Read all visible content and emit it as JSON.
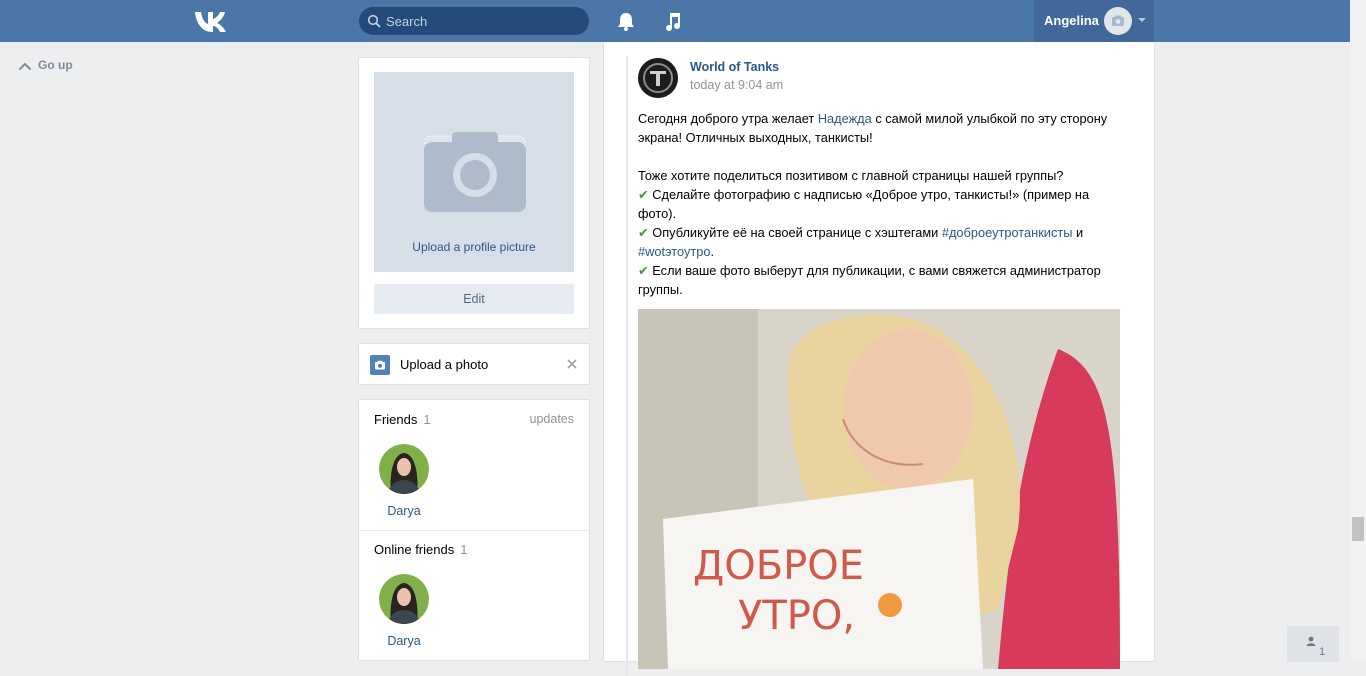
{
  "header": {
    "search_placeholder": "Search",
    "user_name": "Angelina"
  },
  "nav": {
    "go_up": "Go up"
  },
  "profile": {
    "upload_profile_picture": "Upload a profile picture",
    "edit_label": "Edit"
  },
  "upload_photo": {
    "label": "Upload a photo"
  },
  "friends": {
    "title": "Friends",
    "count": "1",
    "updates_label": "updates",
    "items": [
      {
        "name": "Darya"
      }
    ]
  },
  "online_friends": {
    "title": "Online friends",
    "count": "1",
    "items": [
      {
        "name": "Darya"
      }
    ]
  },
  "post": {
    "author": "World of Tanks",
    "time": "today at 9:04 am",
    "p1_a": "Сегодня доброго утра желает ",
    "p1_link": "Надежда",
    "p1_b": " с самой милой улыбкой по эту сторону экрана! Отличных выходных, танкисты!",
    "p2": "Тоже хотите поделиться позитивом с главной страницы нашей группы?",
    "check": "✔",
    "b1": " Сделайте фотографию с надписью «Доброе утро, танкисты!» (пример на фото).",
    "b2_a": " Опубликуйте её на своей странице с хэштегами ",
    "b2_tag1": "#доброеутротанкисты",
    "b2_and": " и ",
    "b2_tag2": "#wotэтоутро",
    "b2_end": ".",
    "b3": " Если ваше фото выберут для публикации, с вами свяжется администратор группы.",
    "sign_line1": "ДОБРОЕ",
    "sign_line2": "УТРО,"
  },
  "chat": {
    "count": "1"
  },
  "colors": {
    "header_bg": "#4a76a8",
    "link": "#2a5885",
    "page_bg": "#edeef0"
  }
}
